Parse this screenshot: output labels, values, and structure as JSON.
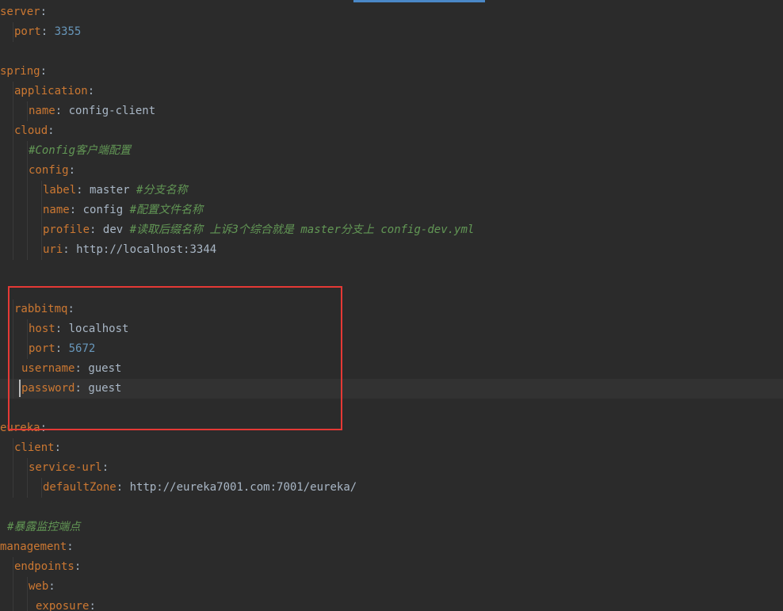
{
  "colors": {
    "background": "#2b2b2b",
    "key": "#cc7832",
    "text": "#a9b7c6",
    "number": "#6897bb",
    "comment": "#629755",
    "highlight_box": "#e53935",
    "tab_indicator": "#4a88c7"
  },
  "lines": [
    {
      "indent": 0,
      "key": "server",
      "value": "",
      "value_type": "text",
      "comment": ""
    },
    {
      "indent": 2,
      "key": "port",
      "value": "3355",
      "value_type": "number",
      "comment": ""
    },
    {
      "indent": 0,
      "key": "",
      "value": "",
      "value_type": "text",
      "comment": ""
    },
    {
      "indent": 0,
      "key": "spring",
      "value": "",
      "value_type": "text",
      "comment": ""
    },
    {
      "indent": 2,
      "key": "application",
      "value": "",
      "value_type": "text",
      "comment": ""
    },
    {
      "indent": 4,
      "key": "name",
      "value": "config-client",
      "value_type": "text",
      "comment": ""
    },
    {
      "indent": 2,
      "key": "cloud",
      "value": "",
      "value_type": "text",
      "comment": ""
    },
    {
      "indent": 4,
      "key": "",
      "value": "",
      "value_type": "text",
      "comment": "#Config客户端配置"
    },
    {
      "indent": 4,
      "key": "config",
      "value": "",
      "value_type": "text",
      "comment": ""
    },
    {
      "indent": 6,
      "key": "label",
      "value": "master",
      "value_type": "text",
      "comment": "#分支名称"
    },
    {
      "indent": 6,
      "key": "name",
      "value": "config",
      "value_type": "text",
      "comment": "#配置文件名称"
    },
    {
      "indent": 6,
      "key": "profile",
      "value": "dev",
      "value_type": "text",
      "comment": "#读取后缀名称 上诉3个综合就是 master分支上 config-dev.yml"
    },
    {
      "indent": 6,
      "key": "uri",
      "value": "http://localhost:3344",
      "value_type": "text",
      "comment": ""
    },
    {
      "indent": 0,
      "key": "",
      "value": "",
      "value_type": "text",
      "comment": ""
    },
    {
      "indent": 0,
      "key": "",
      "value": "",
      "value_type": "text",
      "comment": ""
    },
    {
      "indent": 2,
      "key": "rabbitmq",
      "value": "",
      "value_type": "text",
      "comment": ""
    },
    {
      "indent": 4,
      "key": "host",
      "value": "localhost",
      "value_type": "text",
      "comment": ""
    },
    {
      "indent": 4,
      "key": "port",
      "value": "5672",
      "value_type": "number",
      "comment": ""
    },
    {
      "indent": 3,
      "key": "username",
      "value": "guest",
      "value_type": "text",
      "comment": ""
    },
    {
      "indent": 3,
      "key": "password",
      "value": "guest",
      "value_type": "text",
      "comment": "",
      "current": true
    },
    {
      "indent": 0,
      "key": "",
      "value": "",
      "value_type": "text",
      "comment": ""
    },
    {
      "indent": 0,
      "key": "eureka",
      "value": "",
      "value_type": "text",
      "comment": ""
    },
    {
      "indent": 2,
      "key": "client",
      "value": "",
      "value_type": "text",
      "comment": ""
    },
    {
      "indent": 4,
      "key": "service-url",
      "value": "",
      "value_type": "text",
      "comment": ""
    },
    {
      "indent": 6,
      "key": "defaultZone",
      "value": "http://eureka7001.com:7001/eureka/",
      "value_type": "text",
      "comment": ""
    },
    {
      "indent": 0,
      "key": "",
      "value": "",
      "value_type": "text",
      "comment": ""
    },
    {
      "indent": 1,
      "key": "",
      "value": "",
      "value_type": "text",
      "comment": "#暴露监控端点"
    },
    {
      "indent": 0,
      "key": "management",
      "value": "",
      "value_type": "text",
      "comment": ""
    },
    {
      "indent": 2,
      "key": "endpoints",
      "value": "",
      "value_type": "text",
      "comment": ""
    },
    {
      "indent": 4,
      "key": "web",
      "value": "",
      "value_type": "text",
      "comment": ""
    },
    {
      "indent": 5,
      "key": "exposure",
      "value": "",
      "value_type": "text",
      "comment": ""
    }
  ]
}
